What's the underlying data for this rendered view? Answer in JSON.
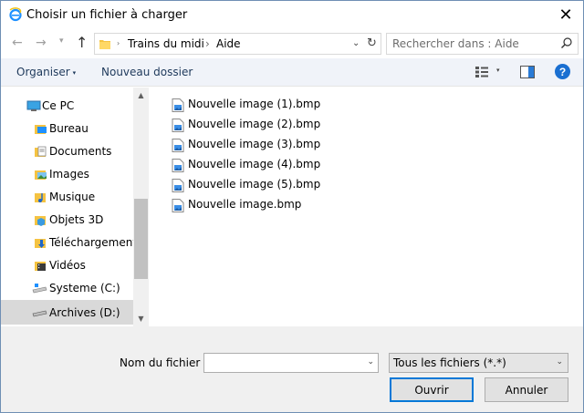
{
  "title": "Choisir un fichier à charger",
  "nav": {
    "breadcrumb": [
      "Trains du midi",
      "Aide"
    ],
    "search_placeholder": "Rechercher dans : Aide"
  },
  "toolbar": {
    "organise": "Organiser",
    "new_folder": "Nouveau dossier",
    "help": "?"
  },
  "sidebar": {
    "items": [
      {
        "label": "Ce PC",
        "icon": "computer-icon"
      },
      {
        "label": "Bureau",
        "icon": "desktop-folder-icon"
      },
      {
        "label": "Documents",
        "icon": "documents-folder-icon"
      },
      {
        "label": "Images",
        "icon": "pictures-folder-icon"
      },
      {
        "label": "Musique",
        "icon": "music-folder-icon"
      },
      {
        "label": "Objets 3D",
        "icon": "3d-objects-folder-icon"
      },
      {
        "label": "Téléchargements",
        "icon": "downloads-folder-icon"
      },
      {
        "label": "Vidéos",
        "icon": "videos-folder-icon"
      },
      {
        "label": "Systeme (C:)",
        "icon": "system-drive-icon"
      },
      {
        "label": "Archives (D:)",
        "icon": "drive-icon",
        "selected": true
      }
    ]
  },
  "files": [
    {
      "name": "Nouvelle image (1).bmp"
    },
    {
      "name": "Nouvelle image (2).bmp"
    },
    {
      "name": "Nouvelle image (3).bmp"
    },
    {
      "name": "Nouvelle image (4).bmp"
    },
    {
      "name": "Nouvelle image (5).bmp"
    },
    {
      "name": "Nouvelle image.bmp"
    }
  ],
  "footer": {
    "filename_label": "Nom du fichier :",
    "filename_value": "",
    "filter": "Tous les fichiers (*.*)",
    "open": "Ouvrir",
    "cancel": "Annuler"
  },
  "colors": {
    "accent": "#0078d7",
    "toolbar_bg": "#f0f3f9",
    "selection": "#d9d9d9"
  }
}
